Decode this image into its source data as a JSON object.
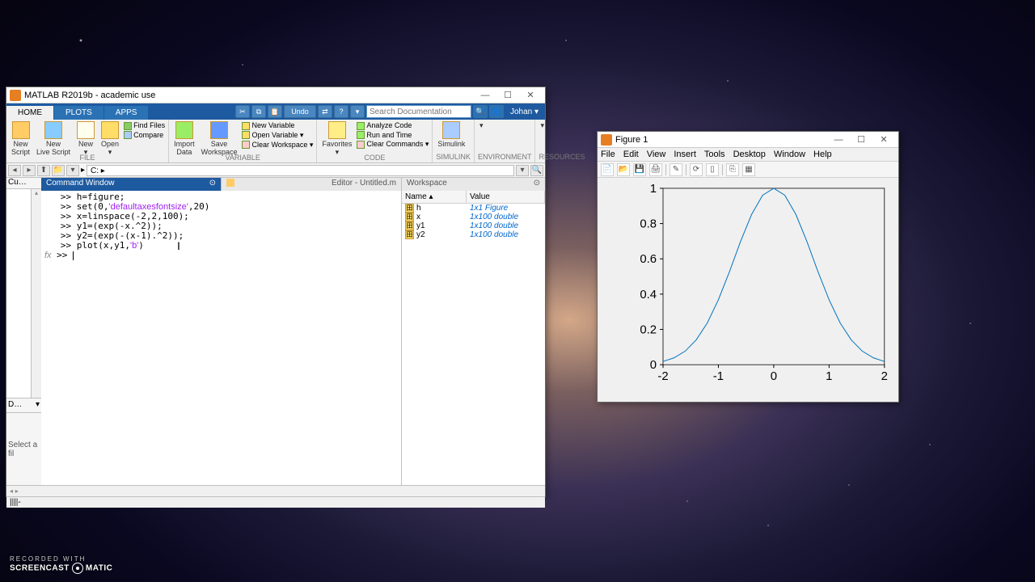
{
  "matlab": {
    "title": "MATLAB R2019b - academic use",
    "tabs": [
      "HOME",
      "PLOTS",
      "APPS"
    ],
    "active_tab": "HOME",
    "qat_undo": "Undo",
    "search_placeholder": "Search Documentation",
    "user": "Johan ▾",
    "ribbon": {
      "file": {
        "new_script": "New\nScript",
        "new_live": "New\nLive Script",
        "new": "New\n▾",
        "open": "Open\n▾",
        "find_files": "Find Files",
        "compare": "Compare",
        "label": "FILE"
      },
      "variable": {
        "import": "Import\nData",
        "save": "Save\nWorkspace",
        "new_var": "New Variable",
        "open_var": "Open Variable ▾",
        "clear_ws": "Clear Workspace ▾",
        "label": "VARIABLE"
      },
      "code": {
        "favorites": "Favorites\n▾",
        "analyze": "Analyze Code",
        "run_time": "Run and Time",
        "clear_cmd": "Clear Commands ▾",
        "label": "CODE"
      },
      "simulink": {
        "btn": "Simulink",
        "label": "SIMULINK"
      },
      "env": {
        "label": "ENVIRONMENT"
      },
      "res": {
        "label": "RESOURCES"
      }
    },
    "path": "C: ▸",
    "current_folder_label": "Cu…",
    "details_label": "D…",
    "select_file": "Select a fil",
    "cmd_title": "Command Window",
    "editor_title": "Editor - Untitled.m",
    "workspace_title": "Workspace",
    "ws_cols": {
      "name": "Name ▴",
      "value": "Value"
    },
    "ws_rows": [
      {
        "name": "h",
        "value": "1x1 Figure"
      },
      {
        "name": "x",
        "value": "1x100 double"
      },
      {
        "name": "y1",
        "value": "1x100 double"
      },
      {
        "name": "y2",
        "value": "1x100 double"
      }
    ],
    "cmd_lines": [
      {
        "p": ">> ",
        "t": "h=figure;"
      },
      {
        "p": ">> ",
        "t": "set(0,",
        "s": "'defaultaxesfontsize'",
        "t2": ",20)"
      },
      {
        "p": ">> ",
        "t": "x=linspace(-2,2,100);"
      },
      {
        "p": ">> ",
        "t": "y1=(exp(-x.^2));"
      },
      {
        "p": ">> ",
        "t": "y2=(exp(-(x-1).^2));"
      },
      {
        "p": ">> ",
        "t": "plot(x,y1,",
        "s": "'b'",
        "t2": ")"
      }
    ],
    "prompt": ">> ",
    "status": "||||-"
  },
  "figure": {
    "title": "Figure 1",
    "menus": [
      "File",
      "Edit",
      "View",
      "Insert",
      "Tools",
      "Desktop",
      "Window",
      "Help"
    ]
  },
  "chart_data": {
    "type": "line",
    "x_range": [
      -2,
      2
    ],
    "y_range": [
      0,
      1
    ],
    "x_ticks": [
      -2,
      -1,
      0,
      1,
      2
    ],
    "y_ticks": [
      0,
      0.2,
      0.4,
      0.6,
      0.8,
      1
    ],
    "series": [
      {
        "name": "y1",
        "color": "#0072bd",
        "expr": "exp(-x^2)",
        "x": [
          -2,
          -1.8,
          -1.6,
          -1.4,
          -1.2,
          -1,
          -0.8,
          -0.6,
          -0.4,
          -0.2,
          0,
          0.2,
          0.4,
          0.6,
          0.8,
          1,
          1.2,
          1.4,
          1.6,
          1.8,
          2
        ],
        "y": [
          0.018,
          0.039,
          0.077,
          0.141,
          0.237,
          0.368,
          0.527,
          0.698,
          0.852,
          0.961,
          1.0,
          0.961,
          0.852,
          0.698,
          0.527,
          0.368,
          0.237,
          0.141,
          0.077,
          0.039,
          0.018
        ]
      }
    ]
  },
  "watermark": {
    "small": "RECORDED WITH",
    "brand1": "SCREENCAST",
    "brand2": "MATIC"
  }
}
